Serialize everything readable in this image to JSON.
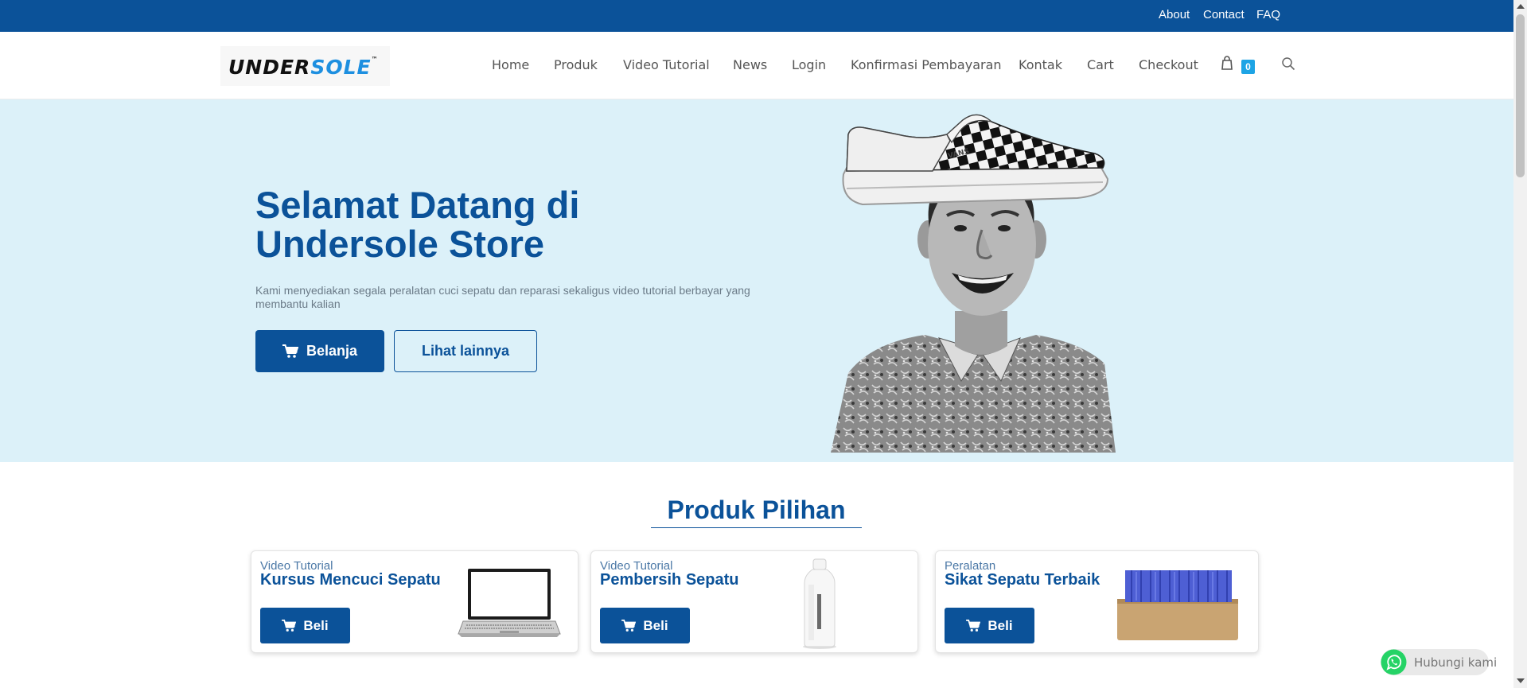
{
  "topbar": {
    "links": [
      "About",
      "Contact",
      "FAQ"
    ]
  },
  "header": {
    "logo": {
      "part1": "UNDER",
      "part2": "SOLE",
      "tm": "™"
    },
    "nav": [
      "Home",
      "Produk",
      "Video Tutorial",
      "News",
      "Login",
      "Konfirmasi Pembayaran",
      "Kontak",
      "Cart",
      "Checkout"
    ],
    "cart_count": "0",
    "icons": {
      "cart": "shopping-bag-icon",
      "search": "search-icon"
    }
  },
  "hero": {
    "title": "Selamat Datang di Undersole Store",
    "subtitle": "Kami menyediakan segala peralatan cuci sepatu dan reparasi sekaligus video tutorial berbayar yang membantu kalian",
    "btn_primary": "Belanja",
    "btn_secondary": "Lihat lainnya",
    "image_brand": "VANS"
  },
  "featured": {
    "title": "Produk Pilihan",
    "cards": [
      {
        "category": "Video Tutorial",
        "name": "Kursus Mencuci Sepatu",
        "button": "Beli",
        "image": "laptop"
      },
      {
        "category": "Video Tutorial",
        "name": "Pembersih Sepatu",
        "button": "Beli",
        "image": "cleaner-bottle"
      },
      {
        "category": "Peralatan",
        "name": "Sikat Sepatu Terbaik",
        "button": "Beli",
        "image": "shoe-brush"
      }
    ]
  },
  "whatsapp": {
    "label": "Hubungi kami"
  },
  "colors": {
    "primary": "#0b5299",
    "hero_bg": "#dcf1f9",
    "badge": "#1da4e5",
    "whatsapp": "#25d366"
  }
}
